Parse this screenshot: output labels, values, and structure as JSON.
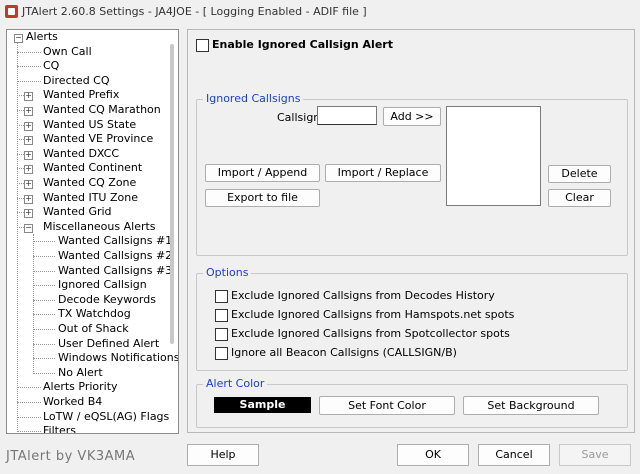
{
  "window": {
    "title": "JTAlert 2.60.8 Settings  -  JA4JOE  -  [ Logging Enabled - ADIF file ]"
  },
  "tree": {
    "root": "Alerts",
    "items": [
      {
        "label": "Own Call"
      },
      {
        "label": "CQ"
      },
      {
        "label": "Directed CQ"
      },
      {
        "label": "Wanted Prefix"
      },
      {
        "label": "Wanted CQ Marathon"
      },
      {
        "label": "Wanted US State"
      },
      {
        "label": "Wanted VE Province"
      },
      {
        "label": "Wanted DXCC"
      },
      {
        "label": "Wanted Continent"
      },
      {
        "label": "Wanted CQ Zone"
      },
      {
        "label": "Wanted ITU Zone"
      },
      {
        "label": "Wanted Grid"
      },
      {
        "label": "Miscellaneous Alerts"
      },
      {
        "label": "Wanted Callsigns #1"
      },
      {
        "label": "Wanted Callsigns #2"
      },
      {
        "label": "Wanted Callsigns #3"
      },
      {
        "label": "Ignored Callsign"
      },
      {
        "label": "Decode Keywords"
      },
      {
        "label": "TX Watchdog"
      },
      {
        "label": "Out of Shack"
      },
      {
        "label": "User Defined Alert"
      },
      {
        "label": "Windows Notifications"
      },
      {
        "label": "No Alert"
      },
      {
        "label": "Alerts Priority"
      },
      {
        "label": "Worked B4"
      },
      {
        "label": "LoTW / eQSL(AG) Flags"
      },
      {
        "label": "Filters"
      }
    ]
  },
  "brand": "JTAlert by VK3AMA",
  "enable": {
    "label": "Enable Ignored Callsign Alert",
    "checked": false
  },
  "ignored": {
    "title": "Ignored Callsigns",
    "callsign_label": "Callsign",
    "callsign_value": "",
    "add_label": "Add >>",
    "import_append": "Import / Append",
    "import_replace": "Import / Replace",
    "export": "Export to file",
    "delete": "Delete",
    "clear": "Clear"
  },
  "options": {
    "title": "Options",
    "items": [
      {
        "label": "Exclude Ignored Callsigns from Decodes History",
        "checked": false
      },
      {
        "label": "Exclude Ignored Callsigns from Hamspots.net spots",
        "checked": false
      },
      {
        "label": "Exclude Ignored Callsigns from Spotcollector spots",
        "checked": false
      },
      {
        "label": "Ignore all Beacon Callsigns (CALLSIGN/B)",
        "checked": false
      }
    ]
  },
  "alert_color": {
    "title": "Alert Color",
    "sample": "Sample",
    "set_font": "Set Font Color",
    "set_background": "Set Background"
  },
  "footer": {
    "help": "Help",
    "ok": "OK",
    "cancel": "Cancel",
    "save": "Save"
  },
  "colors": {
    "group_title": "#1a3fc8",
    "sample_bg": "#000000",
    "sample_fg": "#ffffff"
  }
}
